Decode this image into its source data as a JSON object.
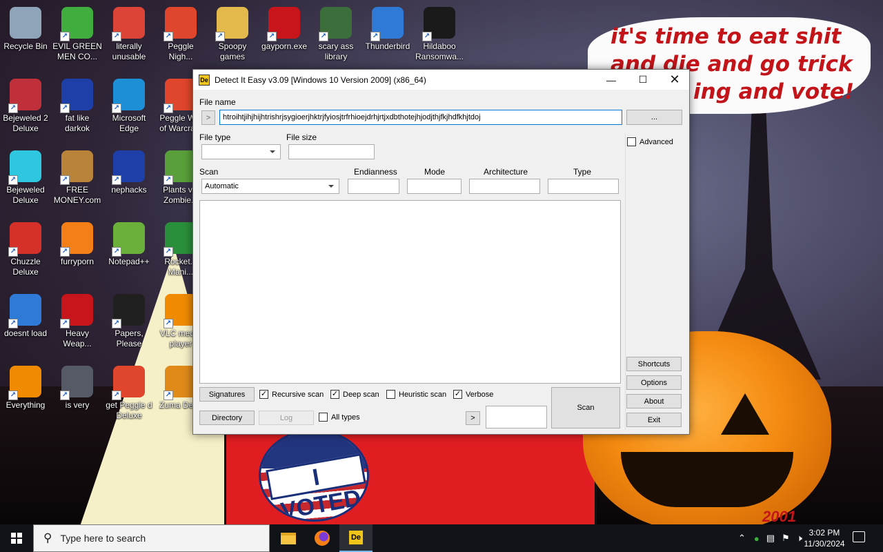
{
  "desktop": {
    "icons": [
      {
        "label": "Recycle Bin",
        "icon": "recycle-bin-icon",
        "color": "#8fa4b8"
      },
      {
        "label": "EVIL GREEN\nMEN CO...",
        "icon": "people-icon",
        "color": "#3fae3f"
      },
      {
        "label": "literally\nunusable",
        "icon": "chrome-icon",
        "color": "#db4437"
      },
      {
        "label": "Peggle\nNigh...",
        "icon": "peggle-icon",
        "color": "#e0462b"
      },
      {
        "label": "Spoopy\ngames",
        "icon": "folder-icon",
        "color": "#e4b94b"
      },
      {
        "label": "gayporn.exe",
        "icon": "flash-icon",
        "color": "#c8141b"
      },
      {
        "label": "scary ass\nlibrary",
        "icon": "library-icon",
        "color": "#3b6e3b"
      },
      {
        "label": "Thunderbird",
        "icon": "thunderbird-icon",
        "color": "#2f7ad6"
      },
      {
        "label": "Hildaboo\nRansomwa...",
        "icon": "shield-icon",
        "color": "#1a1a1a"
      },
      {
        "label": "Bejeweled 2\nDeluxe",
        "icon": "gem-icon",
        "color": "#c0303a"
      },
      {
        "label": "fat like\ndarkok",
        "icon": "mpi-icon",
        "color": "#1f3fa8"
      },
      {
        "label": "Microsoft\nEdge",
        "icon": "edge-icon",
        "color": "#1c8fd6"
      },
      {
        "label": "Peggle W...\nof Warcra...",
        "icon": "peggle-icon",
        "color": "#e0462b"
      },
      {
        "label": "Bejeweled\nDeluxe",
        "icon": "diamond-icon",
        "color": "#2fc6e0"
      },
      {
        "label": "FREE\nMONEY.com",
        "icon": "money-bag-icon",
        "color": "#b9843a"
      },
      {
        "label": "nephacks",
        "icon": "mpi-icon",
        "color": "#1f3fa8"
      },
      {
        "label": "Plants v...\nZombie...",
        "icon": "plants-icon",
        "color": "#5aa03a"
      },
      {
        "label": "Chuzzle\nDeluxe",
        "icon": "chuzzle-icon",
        "color": "#d6302a"
      },
      {
        "label": "furryporn",
        "icon": "firefox-icon",
        "color": "#f57f17"
      },
      {
        "label": "Notepad++",
        "icon": "notepad-icon",
        "color": "#6bb03b"
      },
      {
        "label": "Rocket...\nMani...",
        "icon": "rocket-icon",
        "color": "#2a8f3a"
      },
      {
        "label": "doesnt load",
        "icon": "thunderbird-icon",
        "color": "#2f7ad6"
      },
      {
        "label": "Heavy\nWeap...",
        "icon": "radiation-icon",
        "color": "#c8141b"
      },
      {
        "label": "Papers,\nPlease",
        "icon": "papers-please-icon",
        "color": "#202020"
      },
      {
        "label": "VLC med...\nplayer",
        "icon": "vlc-cone-icon",
        "color": "#f08a00"
      },
      {
        "label": "Everything",
        "icon": "magnifier-icon",
        "color": "#f08a00"
      },
      {
        "label": "is very",
        "icon": "mpi-icon",
        "color": "#555a66"
      },
      {
        "label": "get Peggle d\nDeluxe",
        "icon": "peggle-icon",
        "color": "#e0462b"
      },
      {
        "label": "Zuma Del...",
        "icon": "zuma-icon",
        "color": "#e08a1a"
      }
    ]
  },
  "wallpaper": {
    "speech_line1": "it's time to eat shit",
    "speech_line2": "and die and go trick",
    "speech_line3": "ing and vote!",
    "badge_text": "I VOTED",
    "corner_text": "2001"
  },
  "window": {
    "title": "Detect It Easy v3.09 [Windows 10 Version 2009] (x86_64)",
    "app_icon": "die-icon",
    "file_name_label": "File name",
    "file_name_value": "htroihtjihjhijhtrishrjsygioerjhktrjfyiosjtrfrhioejdrhjrtjxdbthotejhjodjthjfkjhdfkhjtdoj",
    "browse_label": "...",
    "nav_label": ">",
    "file_type_label": "File type",
    "file_size_label": "File size",
    "scan_label": "Scan",
    "scan_value": "Automatic",
    "endianness_label": "Endianness",
    "mode_label": "Mode",
    "architecture_label": "Architecture",
    "type_label": "Type",
    "advanced_label": "Advanced",
    "signatures_label": "Signatures",
    "recursive_label": "Recursive scan",
    "deep_label": "Deep scan",
    "heuristic_label": "Heuristic scan",
    "verbose_label": "Verbose",
    "directory_label": "Directory",
    "log_label": "Log",
    "all_types_label": "All types",
    "arrow_label": ">",
    "scan_button_label": "Scan",
    "shortcuts_label": "Shortcuts",
    "options_label": "Options",
    "about_label": "About",
    "exit_label": "Exit",
    "checks": {
      "advanced": false,
      "recursive": true,
      "deep": true,
      "heuristic": false,
      "verbose": true,
      "all_types": false
    }
  },
  "taskbar": {
    "search_placeholder": "Type here to search",
    "apps": [
      "file-explorer-icon",
      "firefox-icon",
      "die-icon"
    ],
    "time": "3:02 PM",
    "date": "11/30/2024",
    "accent": "#76b9ed"
  }
}
